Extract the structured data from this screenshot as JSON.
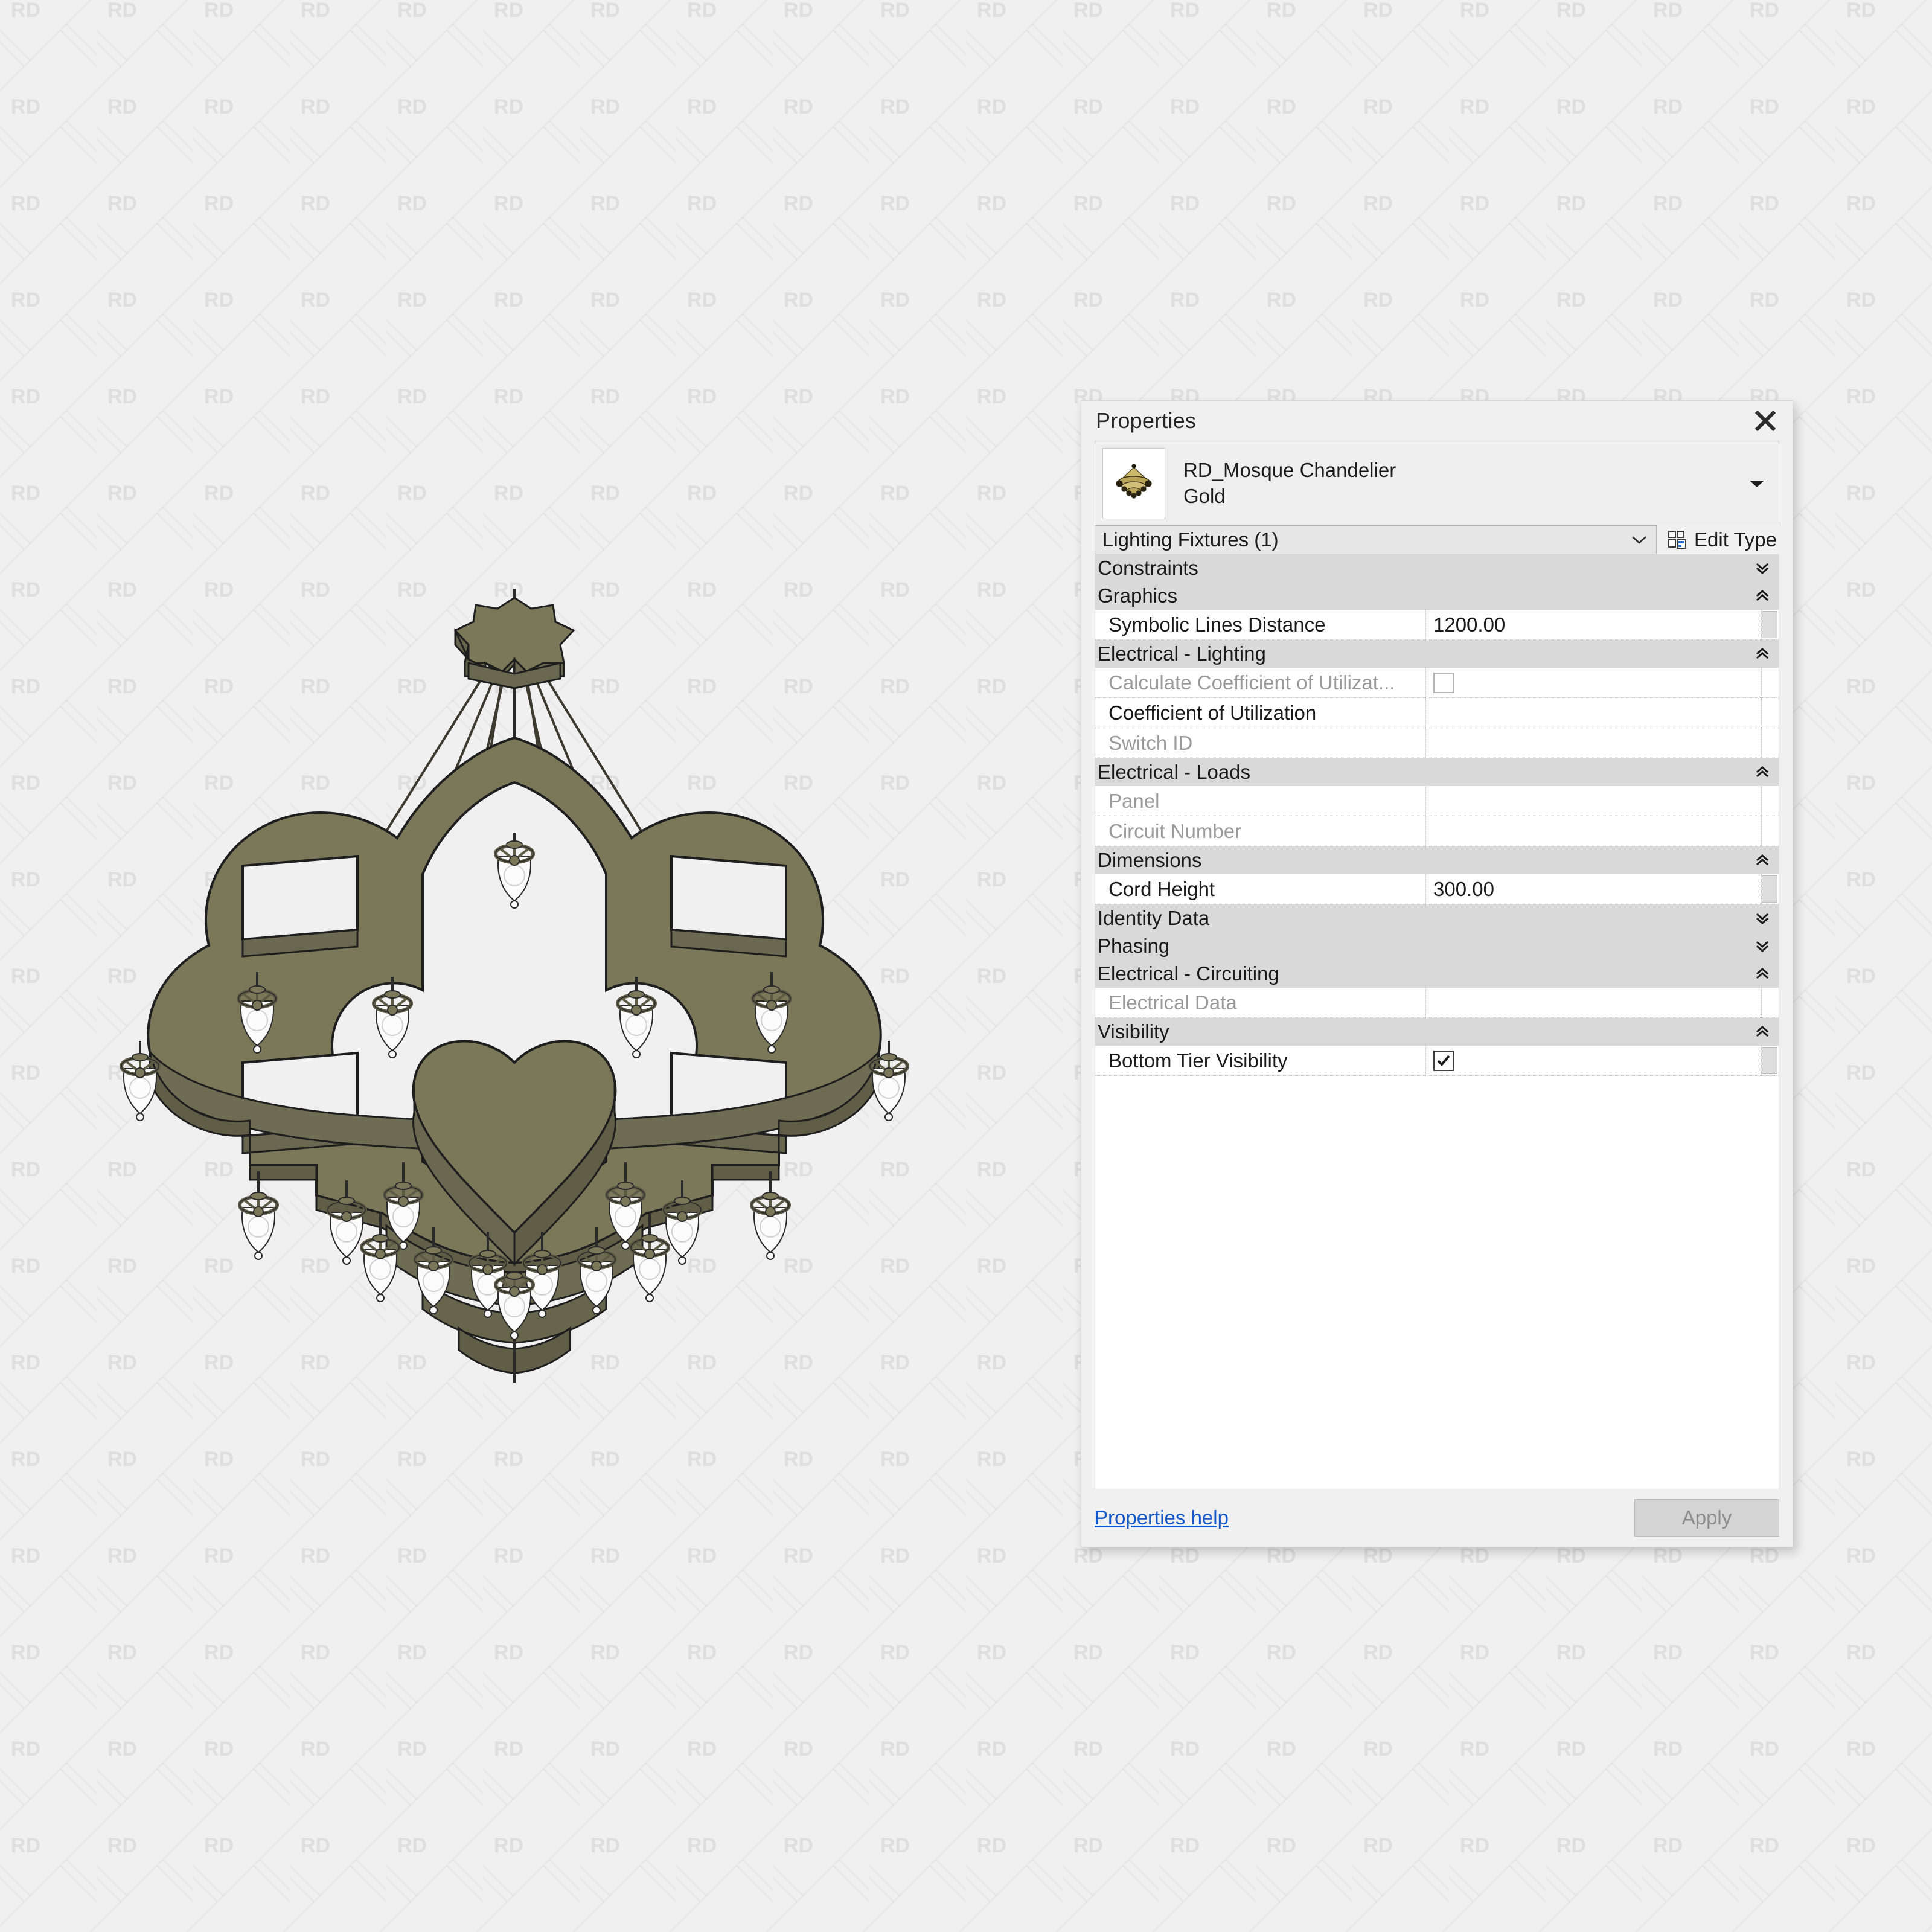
{
  "background": {
    "watermark_text": "RD",
    "watermark_color": "#dedede",
    "page_color": "#f0f0f0"
  },
  "drawing": {
    "name": "RD_Mosque Chandelier Gold 3D view",
    "body_color": "#78765a",
    "body_shade_color": "#6f6d52",
    "body_light_color": "#84815f",
    "outline_color": "#1a1a1a",
    "glass_color": "#fbfbfb",
    "tier_top_lamps": 6,
    "tier_bottom_lamps": 15,
    "cable_count": 8
  },
  "panel": {
    "title": "Properties",
    "close_label": "Close",
    "type": {
      "name_line1": "RD_Mosque Chandelier",
      "name_line2": "Gold",
      "thumbnail_alt": "chandelier-thumbnail"
    },
    "category_selector": {
      "value": "Lighting Fixtures (1)"
    },
    "edit_type": {
      "label": "Edit Type"
    },
    "groups": [
      {
        "label": "Constraints",
        "state": "collapsed",
        "rows": []
      },
      {
        "label": "Graphics",
        "state": "expanded",
        "rows": [
          {
            "label": "Symbolic Lines Distance",
            "value": "1200.00",
            "type": "text",
            "disabled": false,
            "spinner": true
          }
        ]
      },
      {
        "label": "Electrical - Lighting",
        "state": "expanded",
        "rows": [
          {
            "label": "Calculate Coefficient of Utilizat...",
            "value": "",
            "type": "checkbox",
            "checked": false,
            "disabled": true,
            "spinner": false
          },
          {
            "label": "Coefficient of Utilization",
            "value": "",
            "type": "text",
            "disabled": false,
            "spinner": false
          },
          {
            "label": "Switch ID",
            "value": "",
            "type": "text",
            "disabled": true,
            "spinner": false
          }
        ]
      },
      {
        "label": "Electrical - Loads",
        "state": "expanded",
        "rows": [
          {
            "label": "Panel",
            "value": "",
            "type": "text",
            "disabled": true,
            "spinner": false
          },
          {
            "label": "Circuit Number",
            "value": "",
            "type": "text",
            "disabled": true,
            "spinner": false
          }
        ]
      },
      {
        "label": "Dimensions",
        "state": "expanded",
        "rows": [
          {
            "label": "Cord Height",
            "value": "300.00",
            "type": "text",
            "disabled": false,
            "spinner": true
          }
        ]
      },
      {
        "label": "Identity Data",
        "state": "collapsed",
        "rows": []
      },
      {
        "label": "Phasing",
        "state": "collapsed",
        "rows": []
      },
      {
        "label": "Electrical - Circuiting",
        "state": "expanded",
        "rows": [
          {
            "label": "Electrical Data",
            "value": "",
            "type": "text",
            "disabled": true,
            "spinner": false
          }
        ]
      },
      {
        "label": "Visibility",
        "state": "expanded",
        "rows": [
          {
            "label": "Bottom Tier Visibility",
            "value": "",
            "type": "checkbox",
            "checked": true,
            "disabled": false,
            "spinner": true
          }
        ]
      }
    ],
    "footer": {
      "help_link": "Properties help",
      "apply_button": "Apply"
    }
  },
  "colors": {
    "link": "#1458c8",
    "group_header_bg": "#d9d9d9",
    "panel_bg": "#f0f0f0",
    "row_bg": "#ffffff"
  }
}
